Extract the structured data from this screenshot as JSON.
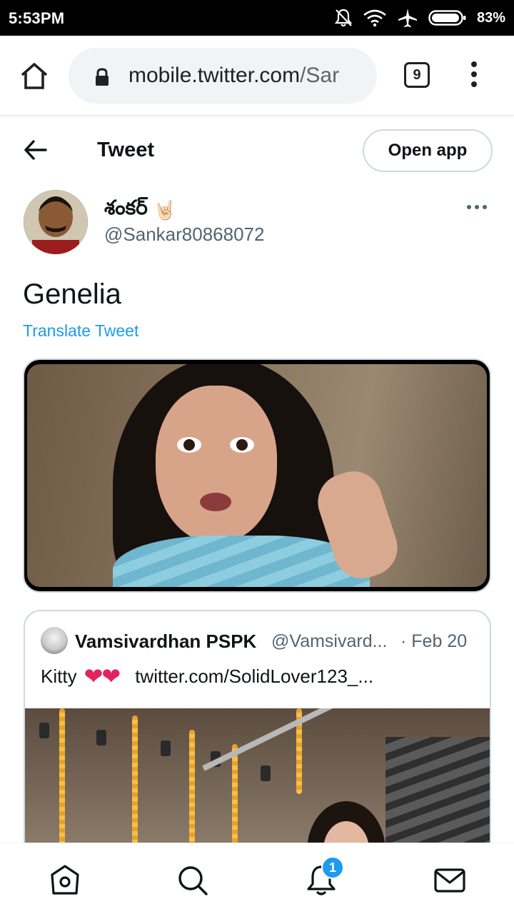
{
  "status_bar": {
    "time": "5:53PM",
    "battery_percent": "83%",
    "icons": [
      "notifications-off-icon",
      "wifi-icon",
      "airplane-icon",
      "battery-icon"
    ]
  },
  "browser": {
    "url_host": "mobile.twitter.com",
    "url_path": "/Sar",
    "tab_count": "9",
    "icons": [
      "home-icon",
      "lock-icon",
      "more-vert-icon"
    ]
  },
  "header": {
    "title": "Tweet",
    "open_app_label": "Open app"
  },
  "tweet": {
    "display_name": "శంకర్",
    "name_emoji": "🤘🏻",
    "handle": "@Sankar80868072",
    "text": "Genelia",
    "translate_label": "Translate Tweet"
  },
  "quoted_tweet": {
    "display_name": "Vamsivardhan PSPK",
    "handle": "@Vamsivard...",
    "date": "· Feb 20",
    "text": "Kitty",
    "hearts": "❤❤",
    "link": "twitter.com/SolidLover123_..."
  },
  "bottom_nav": {
    "items": [
      "home-icon",
      "search-icon",
      "notifications-icon",
      "messages-icon"
    ],
    "notification_badge": "1"
  },
  "colors": {
    "accent": "#1d9bf0",
    "text_primary": "#0f1419",
    "text_secondary": "#536471",
    "border": "#cfd9de",
    "heart": "#e0245e"
  }
}
